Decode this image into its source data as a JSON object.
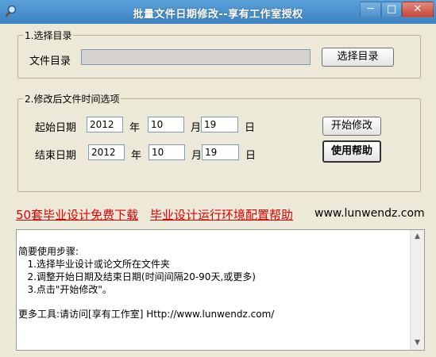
{
  "window": {
    "title": "批量文件日期修改--享有工作室授权",
    "min_glyph": "─",
    "max_glyph": "□",
    "close_glyph": "✕"
  },
  "group1": {
    "legend": "1.选择目录",
    "dir_label": "文件目录",
    "dir_value": "",
    "browse_button": "选择目录"
  },
  "group2": {
    "legend": "2.修改后文件时间选项",
    "start_label": "起始日期",
    "end_label": "结束日期",
    "year_unit": "年",
    "month_unit": "月",
    "day_unit": "日",
    "start": {
      "year": "2012",
      "month": "10",
      "day": "19"
    },
    "end": {
      "year": "2012",
      "month": "10",
      "day": "19"
    },
    "start_button": "开始修改",
    "help_button": "使用帮助"
  },
  "links": {
    "download": "50套毕业设计免费下载",
    "env_help": "毕业设计运行环境配置帮助",
    "site": "www.lunwendz.com"
  },
  "instructions": [
    "简要使用步骤:",
    "   1.选择毕业设计或论文所在文件夹",
    "   2.调整开始日期及结束日期(时间间隔20-90天,或更多)",
    "   3.点击\"开始修改\"。",
    "",
    "更多工具:请访问[享有工作室] Http://www.lunwendz.com/"
  ],
  "colors": {
    "title_bar": "#3c83c4",
    "link_red": "#e00000",
    "window_bg": "#ece9d8"
  },
  "icons": {
    "app": "magnifier-icon"
  }
}
